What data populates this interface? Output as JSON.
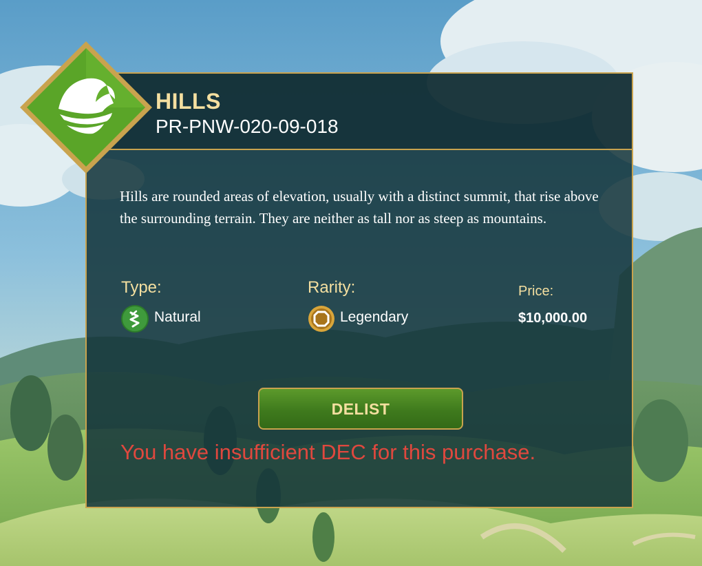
{
  "land": {
    "title": "HILLS",
    "plot_id": "PR-PNW-020-09-018",
    "badge_icon": "hills-icon",
    "description": "Hills are rounded areas of elevation, usually with a distinct summit, that rise above the surrounding terrain. They are neither as tall nor as steep as mountains."
  },
  "stats": {
    "type_label": "Type:",
    "type_value": "Natural",
    "type_icon": "natural-icon",
    "rarity_label": "Rarity:",
    "rarity_value": "Legendary",
    "rarity_icon": "legendary-icon",
    "price_label": "Price:",
    "price_value": "$10,000.00"
  },
  "actions": {
    "delist_label": "DELIST"
  },
  "error_message": "You have insufficient DEC for this purchase.",
  "colors": {
    "accent_gold": "#c9a34e",
    "title_gold": "#f4dfa0",
    "button_green": "#4b8a24",
    "error_red": "#e0483e",
    "panel_teal": "#14343a"
  }
}
